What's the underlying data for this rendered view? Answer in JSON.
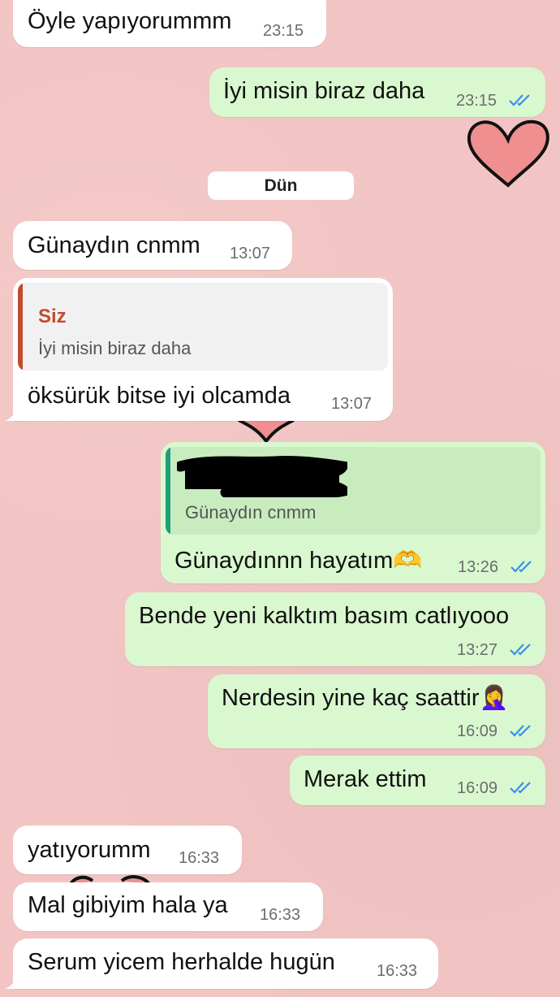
{
  "theme": {
    "wallpaper": "#f2c5c4",
    "incoming": "#ffffff",
    "outgoing": "#d9f8cf",
    "read_tick": "#3a8fe8",
    "reply_name": "#c24b2f",
    "reply_bar_in": "#c24b2f",
    "reply_bar_out": "#1e9e7a"
  },
  "date_divider": "Dün",
  "messages": [
    {
      "text": "Öyle yapıyorummm",
      "time": "23:15",
      "dir": "in"
    },
    {
      "text": "İyi misin biraz daha",
      "time": "23:15",
      "dir": "out",
      "status": "read"
    },
    {
      "text": "Günaydın cnmm",
      "time": "13:07",
      "dir": "in"
    },
    {
      "text": "öksürük bitse iyi olcamda",
      "time": "13:07",
      "dir": "in",
      "reply": {
        "name": "Siz",
        "text": "İyi misin biraz daha"
      }
    },
    {
      "text": "Günaydınnn hayatım🫶",
      "time": "13:26",
      "dir": "out",
      "status": "read",
      "reply": {
        "name": "",
        "text": "Günaydın cnmm"
      }
    },
    {
      "text": "Bende yeni kalktım basım catlıyooo",
      "time": "13:27",
      "dir": "out",
      "status": "read"
    },
    {
      "text": "Nerdesin yine kaç saattir🤦‍♀️",
      "time": "16:09",
      "dir": "out",
      "status": "read"
    },
    {
      "text": "Merak ettim",
      "time": "16:09",
      "dir": "out",
      "status": "read"
    },
    {
      "text": "yatıyorumm",
      "time": "16:33",
      "dir": "in"
    },
    {
      "text": "Mal gibiyim hala ya",
      "time": "16:33",
      "dir": "in"
    },
    {
      "text": "Serum yicem herhalde hugün",
      "time": "16:33",
      "dir": "in"
    }
  ]
}
